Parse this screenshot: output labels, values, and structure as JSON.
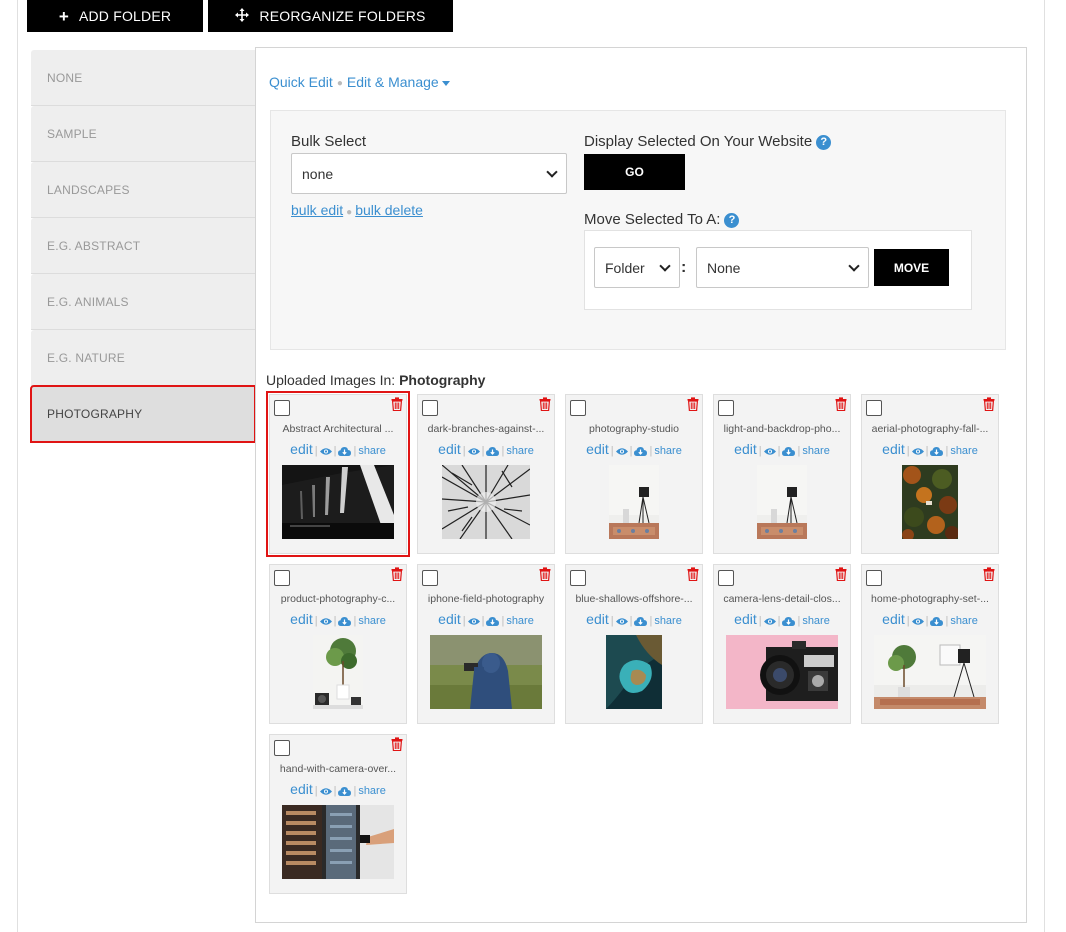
{
  "toolbar": {
    "add_folder_label": "ADD FOLDER",
    "reorganize_label": "REORGANIZE FOLDERS"
  },
  "sidebar": {
    "folders": [
      {
        "label": "NONE"
      },
      {
        "label": "SAMPLE"
      },
      {
        "label": "LANDSCAPES"
      },
      {
        "label": "E.G. ABSTRACT"
      },
      {
        "label": "E.G. ANIMALS"
      },
      {
        "label": "E.G. NATURE"
      },
      {
        "label": "PHOTOGRAPHY"
      }
    ],
    "active_index": 6
  },
  "header_links": {
    "quick_edit": "Quick Edit",
    "edit_manage": "Edit & Manage"
  },
  "bulk": {
    "label": "Bulk Select",
    "selected": "none",
    "bulk_edit": "bulk edit",
    "bulk_delete": "bulk delete"
  },
  "display": {
    "label": "Display Selected On Your Website",
    "help": "?",
    "go_label": "GO"
  },
  "move": {
    "label": "Move Selected To A:",
    "help": "?",
    "type_selected": "Folder",
    "colon": ":",
    "target_selected": "None",
    "move_label": "MOVE"
  },
  "uploaded": {
    "prefix": "Uploaded Images In:",
    "folder": "Photography"
  },
  "card_actions": {
    "edit": "edit",
    "sep": "|",
    "share": "share"
  },
  "images": [
    {
      "name": "Abstract Architectural ...",
      "thumb": "abstract-architecture",
      "selected": true
    },
    {
      "name": "dark-branches-against-...",
      "thumb": "dark-branches"
    },
    {
      "name": "photography-studio",
      "thumb": "studio-white"
    },
    {
      "name": "light-and-backdrop-pho...",
      "thumb": "studio-white"
    },
    {
      "name": "aerial-photography-fall-...",
      "thumb": "aerial-fall"
    },
    {
      "name": "product-photography-c...",
      "thumb": "product-plant"
    },
    {
      "name": "iphone-field-photography",
      "thumb": "field-hoodie"
    },
    {
      "name": "blue-shallows-offshore-...",
      "thumb": "blue-shallows"
    },
    {
      "name": "camera-lens-detail-clos...",
      "thumb": "camera-pink"
    },
    {
      "name": "home-photography-set-...",
      "thumb": "home-set"
    },
    {
      "name": "hand-with-camera-over...",
      "thumb": "hand-camera"
    }
  ],
  "colors": {
    "accent": "#3b8fd0",
    "danger": "#e01414",
    "button_bg": "#000000"
  }
}
